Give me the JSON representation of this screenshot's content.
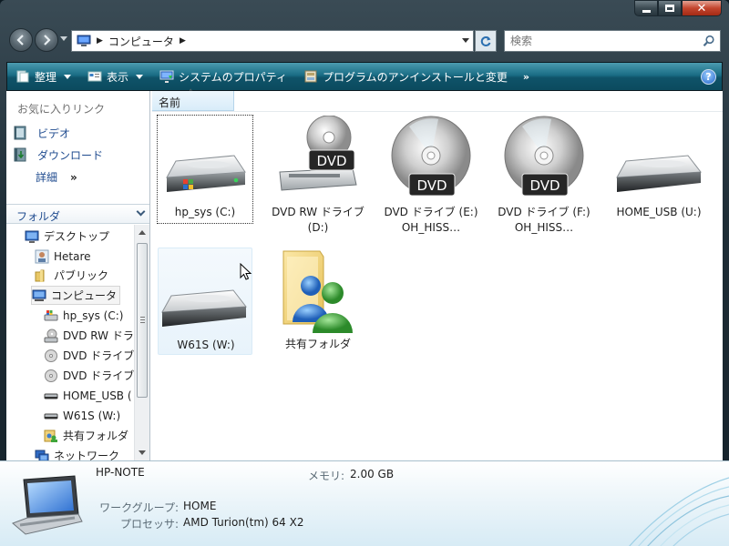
{
  "window": {
    "address": {
      "breadcrumb": "コンピュータ"
    },
    "search": {
      "placeholder": "検索"
    }
  },
  "command_bar": {
    "organize": "整理",
    "views": "表示",
    "system_properties": "システムのプロパティ",
    "uninstall": "プログラムのアンインストールと変更",
    "more": "»"
  },
  "nav_pane": {
    "favorites_header": "お気に入りリンク",
    "favorites": [
      {
        "label": "ビデオ",
        "icon": "video-folder-icon"
      },
      {
        "label": "ダウンロード",
        "icon": "download-folder-icon"
      }
    ],
    "more_label": "詳細",
    "more_chevron": "»",
    "folders_header": "フォルダ",
    "tree": [
      {
        "label": "デスクトップ",
        "icon": "desktop-icon"
      },
      {
        "label": "Hetare",
        "icon": "user-folder-icon"
      },
      {
        "label": "パブリック",
        "icon": "folder-icon"
      },
      {
        "label": "コンピュータ",
        "icon": "computer-icon"
      },
      {
        "label": "hp_sys (C:)",
        "icon": "windows-drive-icon"
      },
      {
        "label": "DVD RW ドラ",
        "icon": "dvd-rw-drive-icon"
      },
      {
        "label": "DVD ドライブ",
        "icon": "dvd-drive-icon"
      },
      {
        "label": "DVD ドライブ",
        "icon": "dvd-drive-icon"
      },
      {
        "label": "HOME_USB (",
        "icon": "usb-drive-icon"
      },
      {
        "label": "W61S (W:)",
        "icon": "network-drive-icon"
      },
      {
        "label": "共有フォルダ",
        "icon": "shared-folder-icon"
      },
      {
        "label": "ネットワーク",
        "icon": "network-icon"
      }
    ]
  },
  "content": {
    "column_name": "名前",
    "sort_glyph": "˄",
    "items": [
      {
        "label": "hp_sys (C:)",
        "icon": "windows-drive-icon"
      },
      {
        "label": "DVD RW ドライブ (D:)",
        "icon": "dvd-rw-drive-icon",
        "disc_label": "DVD"
      },
      {
        "label": "DVD ドライブ (E:) OH_HISS…",
        "icon": "dvd-drive-icon",
        "disc_label": "DVD"
      },
      {
        "label": "DVD ドライブ (F:) OH_HISS…",
        "icon": "dvd-drive-icon",
        "disc_label": "DVD"
      },
      {
        "label": "HOME_USB (U:)",
        "icon": "usb-drive-icon"
      },
      {
        "label": "W61S (W:)",
        "icon": "network-drive-icon"
      },
      {
        "label": "共有フォルダ",
        "icon": "shared-folder-icon"
      }
    ]
  },
  "details": {
    "name": "HP-NOTE",
    "memory_label": "メモリ:",
    "memory_value": "2.00 GB",
    "workgroup_label": "ワークグループ:",
    "workgroup_value": "HOME",
    "processor_label": "プロセッサ:",
    "processor_value": "AMD Turion(tm) 64 X2"
  },
  "colors": {
    "command_bar": "#0f5369",
    "link": "#1f4b8f",
    "selection": "#e8f3fb"
  }
}
